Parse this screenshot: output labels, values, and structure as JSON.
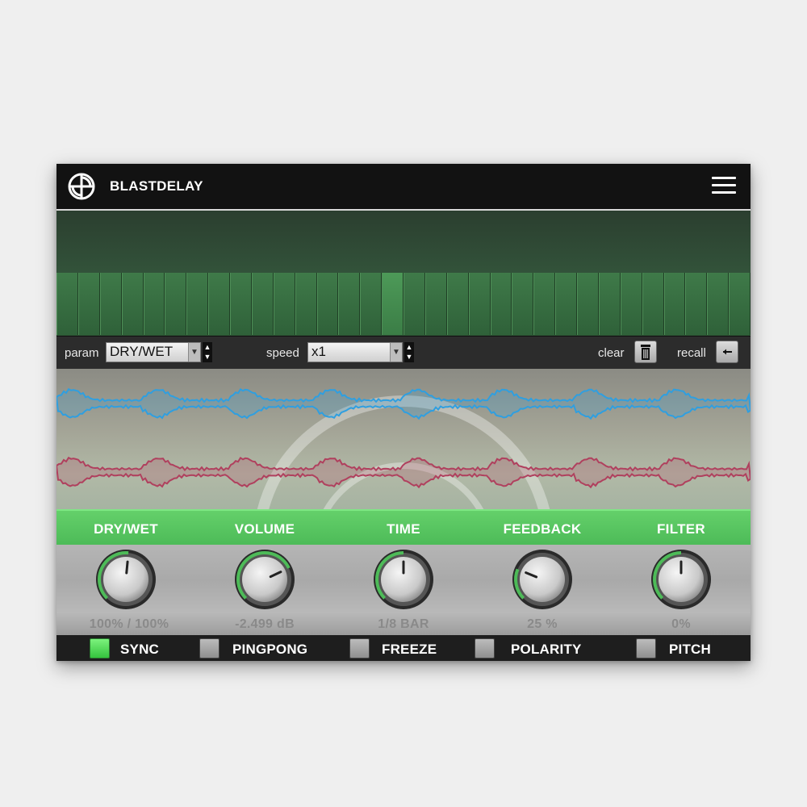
{
  "app": {
    "title": "BLASTDELAY"
  },
  "controls": {
    "param_label": "param",
    "param_value": "DRY/WET",
    "speed_label": "speed",
    "speed_value": "x1",
    "clear_label": "clear",
    "recall_label": "recall"
  },
  "sequencer": {
    "steps": 32,
    "active_step": 15
  },
  "params": [
    {
      "label": "DRY/WET",
      "value": "100% / 100%",
      "level": 0.52
    },
    {
      "label": "VOLUME",
      "value": "-2.499 dB",
      "level": 0.74
    },
    {
      "label": "TIME",
      "value": "1/8 BAR",
      "level": 0.5
    },
    {
      "label": "FEEDBACK",
      "value": "25 %",
      "level": 0.25
    },
    {
      "label": "FILTER",
      "value": "0%",
      "level": 0.5
    }
  ],
  "toggles": [
    {
      "label": "SYNC",
      "on": true
    },
    {
      "label": "PINGPONG",
      "on": false
    },
    {
      "label": "FREEZE",
      "on": false
    },
    {
      "label": "POLARITY",
      "on": false
    },
    {
      "label": "PITCH",
      "on": false
    }
  ],
  "colors": {
    "accent_green": "#4dbb58",
    "wave_left": "#2f9fe0",
    "wave_right": "#b0405e"
  },
  "icons": {
    "logo": "logo-icon",
    "menu": "hamburger-menu-icon",
    "clear": "trash-icon",
    "recall": "arrow-left-icon"
  }
}
